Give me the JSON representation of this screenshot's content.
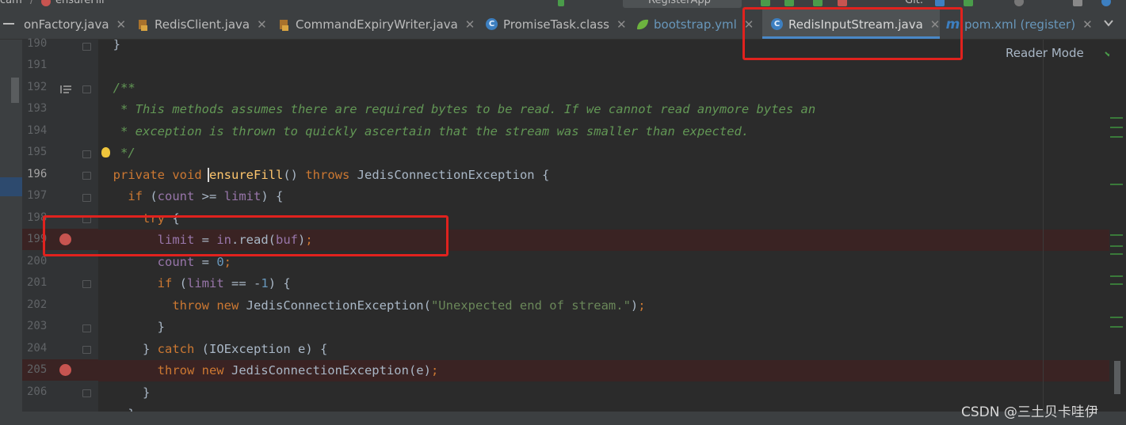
{
  "topbar": {
    "crumb_left": "cam",
    "crumb_method": "ensureFill",
    "run_config": "RegisterApp",
    "vcs_label": "Git:"
  },
  "tabs": [
    {
      "label": "onFactory.java",
      "icon": "java-class-icon",
      "active": false
    },
    {
      "label": "RedisClient.java",
      "icon": "java-class-icon",
      "active": false
    },
    {
      "label": "CommandExpiryWriter.java",
      "icon": "java-class-icon",
      "active": false
    },
    {
      "label": "PromiseTask.class",
      "icon": "class-file-icon",
      "active": false
    },
    {
      "label": "bootstrap.yml",
      "icon": "spring-yml-icon",
      "active": false
    },
    {
      "label": "RedisInputStream.java",
      "icon": "java-class-icon",
      "active": true
    },
    {
      "label": "pom.xml (register)",
      "icon": "maven-icon",
      "active": false
    }
  ],
  "editor": {
    "reader_mode": "Reader Mode",
    "line_numbers": [
      "190",
      "191",
      "192",
      "193",
      "194",
      "195",
      "196",
      "197",
      "198",
      "199",
      "200",
      "201",
      "202",
      "203",
      "204",
      "205",
      "206"
    ],
    "current_line": "196",
    "breakpoint_lines": [
      "199",
      "205"
    ],
    "code_lines": [
      "}",
      "",
      "/**",
      " * This methods assumes there are required bytes to be read. If we cannot read anymore bytes an",
      " * exception is thrown to quickly ascertain that the stream was smaller than expected.",
      " */",
      "private void ensureFill() throws JedisConnectionException {",
      "  if (count >= limit) {",
      "    try {",
      "      limit = in.read(buf);",
      "      count = 0;",
      "      if (limit == -1) {",
      "        throw new JedisConnectionException(\"Unexpected end of stream.\");",
      "      }",
      "    } catch (IOException e) {",
      "      throw new JedisConnectionException(e);",
      "    }"
    ]
  },
  "watermark": "CSDN @三土贝卡哇伊",
  "colors": {
    "keyword": "#cc7832",
    "comment": "#629755",
    "field": "#9876aa",
    "method": "#ffc66d",
    "string": "#6a8759",
    "number": "#6897bb",
    "annotation_box": "#e0221e"
  }
}
